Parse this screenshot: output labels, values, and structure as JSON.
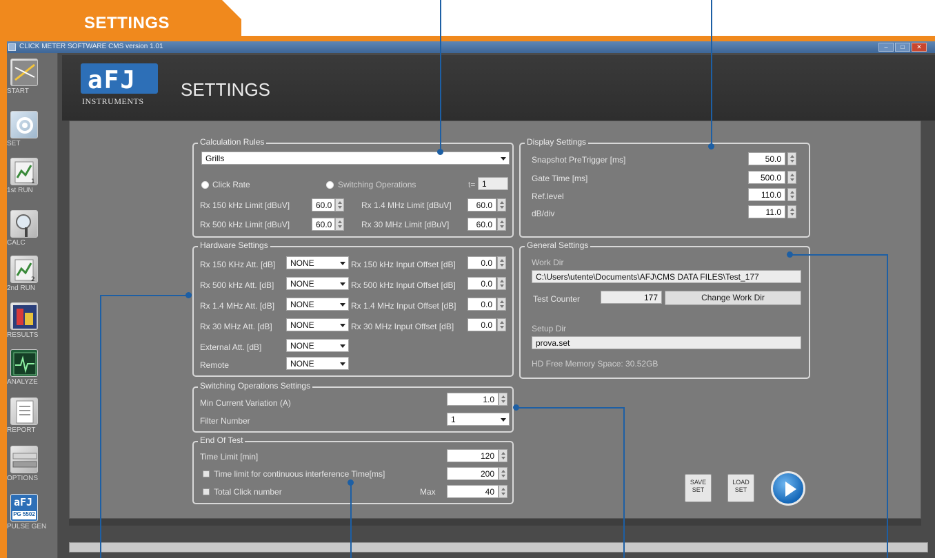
{
  "header": {
    "tab_title": "SETTINGS"
  },
  "window": {
    "title": "CLICK METER SOFTWARE CMS version 1.01"
  },
  "sidebar": {
    "items": [
      {
        "label": "START",
        "icon": "start-icon"
      },
      {
        "label": "SET",
        "icon": "set-icon"
      },
      {
        "label": "1st RUN",
        "icon": "run-icon"
      },
      {
        "label": "CALC",
        "icon": "magnifier-icon"
      },
      {
        "label": "2nd RUN",
        "icon": "run-icon"
      },
      {
        "label": "RESULTS",
        "icon": "results-icon"
      },
      {
        "label": "ANALYZE",
        "icon": "analyze-icon"
      },
      {
        "label": "REPORT",
        "icon": "report-icon"
      },
      {
        "label": "OPTIONS",
        "icon": "options-icon"
      },
      {
        "label": "PULSE GEN",
        "icon": "pulse-gen-icon",
        "logo_text": "aFJ",
        "badge": "PG 5502"
      }
    ]
  },
  "brand": {
    "logo_letters": "aFJ",
    "logo_sub": "INSTRUMENTS"
  },
  "page": {
    "title": "SETTINGS"
  },
  "calc": {
    "title": "Calculation Rules",
    "rule": "Grills",
    "click_rate": "Click Rate",
    "switching": "Switching Operations",
    "t_label": "t=",
    "t_value": "1",
    "rx150_label": "Rx 150 kHz Limit [dBuV]",
    "rx150": "60.0",
    "rx500_label": "Rx 500 kHz Limit [dBuV]",
    "rx500": "60.0",
    "rx14_label": "Rx 1.4 MHz Limit [dBuV]",
    "rx14": "60.0",
    "rx30_label": "Rx 30 MHz Limit [dBuV]",
    "rx30": "60.0"
  },
  "display": {
    "title": "Display Settings",
    "rows": [
      {
        "label": "Snapshot PreTrigger [ms]",
        "value": "50.0"
      },
      {
        "label": "Gate Time [ms]",
        "value": "500.0"
      },
      {
        "label": "Ref.level",
        "value": "110.0"
      },
      {
        "label": "dB/div",
        "value": "11.0"
      }
    ]
  },
  "hardware": {
    "title": "Hardware Settings",
    "rows": [
      {
        "att_label": "Rx 150 KHz Att. [dB]",
        "att": "NONE",
        "off_label": "Rx 150 kHz Input Offset [dB]",
        "off": "0.0"
      },
      {
        "att_label": "Rx 500 kHz Att. [dB]",
        "att": "NONE",
        "off_label": "Rx 500 kHz Input Offset [dB]",
        "off": "0.0"
      },
      {
        "att_label": "Rx 1.4 MHz Att. [dB]",
        "att": "NONE",
        "off_label": "Rx 1.4 MHz Input Offset [dB]",
        "off": "0.0"
      },
      {
        "att_label": "Rx 30 MHz Att. [dB]",
        "att": "NONE",
        "off_label": "Rx 30 MHz Input Offset [dB]",
        "off": "0.0"
      }
    ],
    "external_label": "External Att. [dB]",
    "external": "NONE",
    "remote_label": "Remote",
    "remote": "NONE"
  },
  "general": {
    "title": "General Settings",
    "work_dir_label": "Work Dir",
    "work_dir": "C:\\Users\\utente\\Documents\\AFJ\\CMS DATA FILES\\Test_177",
    "test_counter_label": "Test Counter",
    "test_counter": "177",
    "change_work_dir": "Change Work Dir",
    "setup_dir_label": "Setup Dir",
    "setup_dir": "prova.set",
    "hd_free": "HD Free Memory Space: 30.52GB"
  },
  "switching": {
    "title": "Switching Operations Settings",
    "min_current_label": "Min Current Variation (A)",
    "min_current": "1.0",
    "filter_label": "Filter Number",
    "filter": "1"
  },
  "end_test": {
    "title": "End Of Test",
    "time_limit_label": "Time Limit [min]",
    "time_limit": "120",
    "continuous_label": "Time limit for continuous interference Time[ms]",
    "continuous": "200",
    "total_label": "Total Click number",
    "max_label": "Max",
    "max": "40"
  },
  "actions": {
    "save": "SAVE SET",
    "load": "LOAD SET"
  }
}
